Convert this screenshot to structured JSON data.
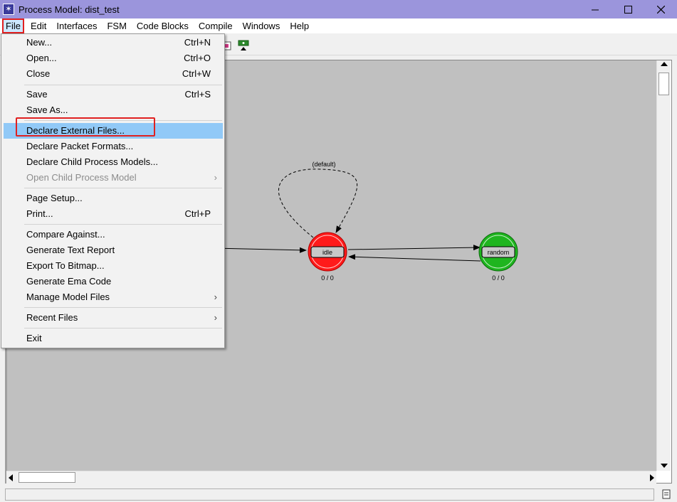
{
  "window": {
    "title": "Process Model: dist_test",
    "app_icon": "star-icon"
  },
  "menubar": [
    "File",
    "Edit",
    "Interfaces",
    "FSM",
    "Code Blocks",
    "Compile",
    "Windows",
    "Help"
  ],
  "file_menu": [
    {
      "label": "New...",
      "shortcut": "Ctrl+N"
    },
    {
      "label": "Open...",
      "shortcut": "Ctrl+O"
    },
    {
      "label": "Close",
      "shortcut": "Ctrl+W"
    },
    {
      "label": "Save",
      "shortcut": "Ctrl+S"
    },
    {
      "label": "Save As...",
      "shortcut": ""
    },
    {
      "label": "Declare External Files...",
      "shortcut": ""
    },
    {
      "label": "Declare Packet Formats...",
      "shortcut": ""
    },
    {
      "label": "Declare Child Process Models...",
      "shortcut": ""
    },
    {
      "label": "Open Child Process Model",
      "shortcut": "",
      "submenu": "›"
    },
    {
      "label": "Page Setup...",
      "shortcut": ""
    },
    {
      "label": "Print...",
      "shortcut": "Ctrl+P"
    },
    {
      "label": "Compare Against...",
      "shortcut": ""
    },
    {
      "label": "Generate Text Report",
      "shortcut": ""
    },
    {
      "label": "Export To Bitmap...",
      "shortcut": ""
    },
    {
      "label": "Generate Ema Code",
      "shortcut": ""
    },
    {
      "label": "Manage Model Files",
      "shortcut": "",
      "submenu": "›"
    },
    {
      "label": "Recent Files",
      "shortcut": "",
      "submenu": "›"
    },
    {
      "label": "Exit",
      "shortcut": ""
    }
  ],
  "diagram": {
    "states": [
      {
        "name": "idle",
        "counter": "0 / 0",
        "color": "#ff1a1a"
      },
      {
        "name": "random",
        "counter": "0 / 0",
        "color": "#1fb51f"
      }
    ],
    "self_transition_label": "(default)"
  },
  "colors": {
    "titlebar": "#9b95dc",
    "menu_highlight": "#91c9f7",
    "annotation": "#e02020"
  }
}
